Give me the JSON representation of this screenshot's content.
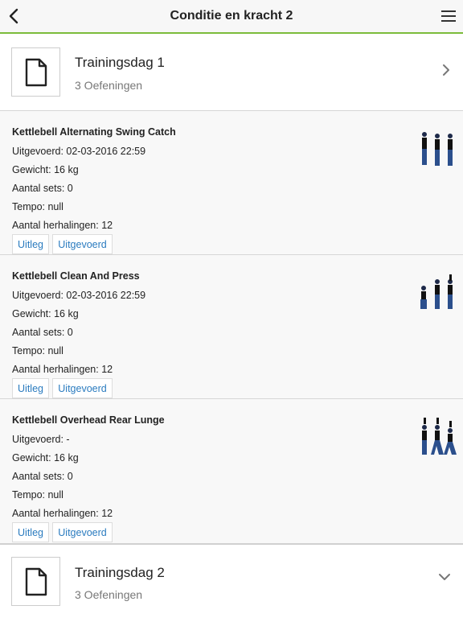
{
  "header": {
    "title": "Conditie en kracht 2",
    "back_icon": "chevron-left-icon",
    "menu_icon": "hamburger-menu-icon",
    "accent_color": "#7cbc3b"
  },
  "days": [
    {
      "title": "Trainingsdag 1",
      "subtitle": "3 Oefeningen",
      "icon": "document-icon",
      "chevron": "chevron-right-icon"
    },
    {
      "title": "Trainingsdag 2",
      "subtitle": "3 Oefeningen",
      "icon": "document-icon",
      "chevron": "chevron-down-icon"
    }
  ],
  "exercises": [
    {
      "name": "Kettlebell Alternating Swing Catch",
      "performed": "Uitgevoerd: 02-03-2016 22:59",
      "weight": "Gewicht: 16 kg",
      "sets": "Aantal sets: 0",
      "tempo": "Tempo: null",
      "reps": "Aantal herhalingen: 12",
      "btn_explain": "Uitleg",
      "btn_done": "Uitgevoerd"
    },
    {
      "name": "Kettlebell Clean And Press",
      "performed": "Uitgevoerd: 02-03-2016 22:59",
      "weight": "Gewicht: 16 kg",
      "sets": "Aantal sets: 0",
      "tempo": "Tempo: null",
      "reps": "Aantal herhalingen: 12",
      "btn_explain": "Uitleg",
      "btn_done": "Uitgevoerd"
    },
    {
      "name": "Kettlebell Overhead Rear Lunge",
      "performed": "Uitgevoerd: -",
      "weight": "Gewicht: 16 kg",
      "sets": "Aantal sets: 0",
      "tempo": "Tempo: null",
      "reps": "Aantal herhalingen: 12",
      "btn_explain": "Uitleg",
      "btn_done": "Uitgevoerd"
    }
  ]
}
